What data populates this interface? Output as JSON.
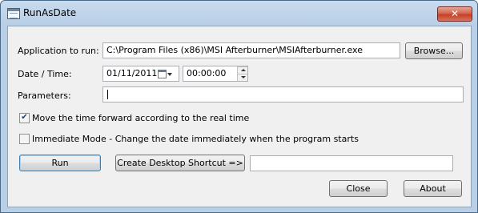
{
  "window": {
    "title": "RunAsDate",
    "close_glyph": "✕",
    "icon": "app-window-icon"
  },
  "form": {
    "app_label": "Application to run:",
    "app_path": "C:\\Program Files (x86)\\MSI Afterburner\\MSIAfterburner.exe",
    "browse_label": "Browse...",
    "datetime_label": "Date / Time:",
    "date_value": "01/11/2011",
    "time_value": "00:00:00",
    "params_label": "Parameters:",
    "params_value": "",
    "move_time_label": "Move the time forward according to the real time",
    "move_time_checked": true,
    "immediate_label": "Immediate Mode - Change the date immediately when the program starts",
    "immediate_checked": false,
    "check_glyph": "✔"
  },
  "buttons": {
    "run": "Run",
    "shortcut": "Create Desktop Shortcut =>",
    "shortcut_name_value": "",
    "close": "Close",
    "about": "About"
  }
}
